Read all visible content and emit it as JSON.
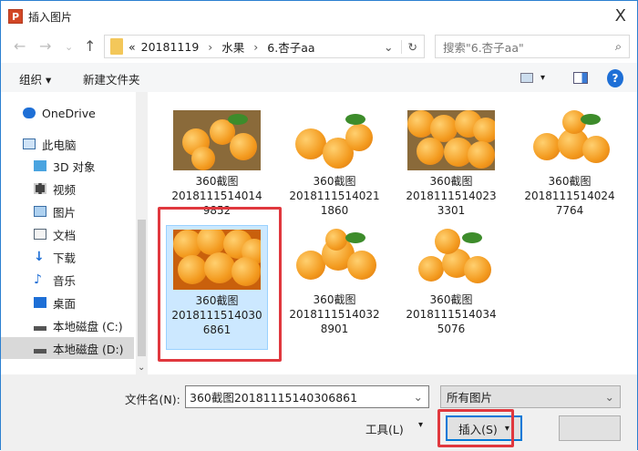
{
  "window": {
    "title": "插入图片",
    "close": "X",
    "app_icon": "P"
  },
  "nav": {
    "back": "←",
    "forward": "→",
    "recent": "⌄",
    "up": "↑",
    "path_prefix": "«",
    "breadcrumbs": [
      "20181119",
      "水果",
      "6.杏子aa"
    ],
    "sep": "›",
    "dropdown": "⌄",
    "refresh": "↻"
  },
  "search": {
    "placeholder": "搜索\"6.杏子aa\"",
    "icon": "⌕"
  },
  "toolbar": {
    "organize": "组织 ▾",
    "new_folder": "新建文件夹",
    "view_arrow": "▾",
    "help": "?"
  },
  "sidebar": {
    "items": [
      {
        "label": "OneDrive",
        "icon": "cloud"
      },
      {
        "label": "此电脑",
        "icon": "computer"
      },
      {
        "label": "3D 对象",
        "icon": "cube"
      },
      {
        "label": "视频",
        "icon": "film"
      },
      {
        "label": "图片",
        "icon": "picture"
      },
      {
        "label": "文档",
        "icon": "document"
      },
      {
        "label": "下载",
        "icon": "download"
      },
      {
        "label": "音乐",
        "icon": "music"
      },
      {
        "label": "桌面",
        "icon": "desktop"
      },
      {
        "label": "本地磁盘 (C:)",
        "icon": "drive"
      },
      {
        "label": "本地磁盘 (D:)",
        "icon": "drive"
      }
    ],
    "scroll_down": "⌄"
  },
  "files": [
    {
      "l1": "360截图",
      "l2": "2018111514014",
      "l3": "9852"
    },
    {
      "l1": "360截图",
      "l2": "2018111514021",
      "l3": "1860"
    },
    {
      "l1": "360截图",
      "l2": "2018111514023",
      "l3": "3301"
    },
    {
      "l1": "360截图",
      "l2": "2018111514024",
      "l3": "7764"
    },
    {
      "l1": "360截图",
      "l2": "2018111514030",
      "l3": "6861",
      "selected": true
    },
    {
      "l1": "360截图",
      "l2": "2018111514032",
      "l3": "8901"
    },
    {
      "l1": "360截图",
      "l2": "2018111514034",
      "l3": "5076"
    }
  ],
  "footer": {
    "filename_label": "文件名(N):",
    "filename_value": "360截图20181115140306861",
    "filter": "所有图片",
    "tools": "工具(L)",
    "tools_arrow": "▾",
    "insert": "插入(S)",
    "insert_arrow": "▾"
  },
  "colors": {
    "accent": "#0078d7",
    "highlight": "#e0383e",
    "selection": "#cce8ff"
  }
}
